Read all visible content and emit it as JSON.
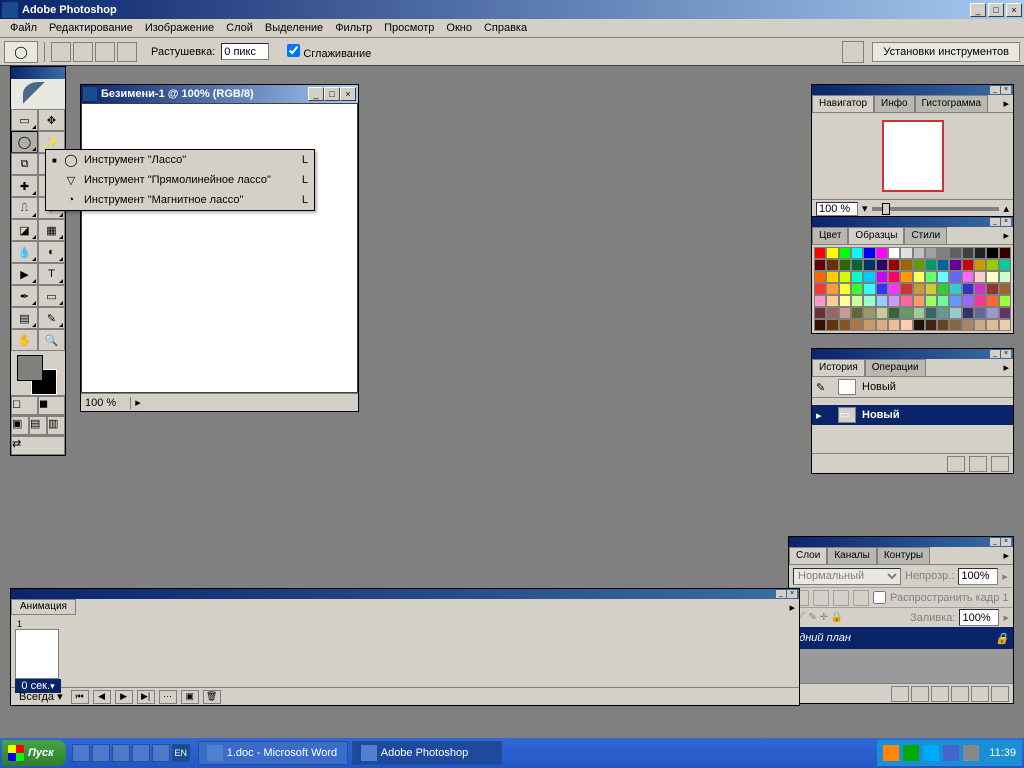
{
  "app": {
    "title": "Adobe Photoshop"
  },
  "menubar": [
    "Файл",
    "Редактирование",
    "Изображение",
    "Слой",
    "Выделение",
    "Фильтр",
    "Просмотр",
    "Окно",
    "Справка"
  ],
  "options": {
    "feather_label": "Растушевка:",
    "feather_value": "0 пикс",
    "antialias_label": "Сглаживание",
    "presets": "Установки инструментов"
  },
  "document": {
    "title": "Безимени-1 @ 100% (RGB/8)",
    "zoom": "100 %"
  },
  "flyout": {
    "items": [
      {
        "label": "Инструмент \"Лассо\"",
        "key": "L",
        "active": true
      },
      {
        "label": "Инструмент \"Прямолинейное лассо\"",
        "key": "L",
        "active": false
      },
      {
        "label": "Инструмент \"Магнитное лассо\"",
        "key": "L",
        "active": false
      }
    ]
  },
  "navigator": {
    "tabs": [
      "Навигатор",
      "Инфо",
      "Гистограмма"
    ],
    "zoom": "100 %"
  },
  "color": {
    "tabs": [
      "Цвет",
      "Образцы",
      "Стили"
    ]
  },
  "swatches": [
    "#ff0000",
    "#ffff00",
    "#00ff00",
    "#00ffff",
    "#0000ff",
    "#ff00ff",
    "#ffffff",
    "#e0e0e0",
    "#c0c0c0",
    "#a0a0a0",
    "#808080",
    "#606060",
    "#404040",
    "#202020",
    "#000000",
    "#330000",
    "#660000",
    "#663300",
    "#336600",
    "#006633",
    "#003366",
    "#330066",
    "#990000",
    "#996600",
    "#669900",
    "#009966",
    "#006699",
    "#660099",
    "#cc0000",
    "#cc9900",
    "#99cc00",
    "#00cc99",
    "#ff6600",
    "#ffcc00",
    "#ccff00",
    "#00ffcc",
    "#00ccff",
    "#cc00ff",
    "#ff0066",
    "#ff9900",
    "#ffff66",
    "#66ff66",
    "#66ffff",
    "#6666ff",
    "#ff66ff",
    "#ffcccc",
    "#ffffcc",
    "#ccffcc",
    "#ff3333",
    "#ff9933",
    "#ffff33",
    "#33ff33",
    "#33ffff",
    "#3333ff",
    "#ff33ff",
    "#cc3333",
    "#cc9933",
    "#cccc33",
    "#33cc33",
    "#33cccc",
    "#3333cc",
    "#cc33cc",
    "#993333",
    "#996633",
    "#ff99cc",
    "#ffcc99",
    "#ffff99",
    "#ccff99",
    "#99ffcc",
    "#99ccff",
    "#cc99ff",
    "#ff6699",
    "#ff9966",
    "#99ff66",
    "#66ff99",
    "#6699ff",
    "#9966ff",
    "#ff3399",
    "#ff6633",
    "#99ff33",
    "#663333",
    "#996666",
    "#cc9999",
    "#666633",
    "#999966",
    "#cccc99",
    "#336633",
    "#669966",
    "#99cc99",
    "#336666",
    "#669999",
    "#99cccc",
    "#333366",
    "#666699",
    "#9999cc",
    "#663366",
    "#331100",
    "#663311",
    "#885522",
    "#aa7744",
    "#cc9966",
    "#ddaa88",
    "#eebb99",
    "#ffccaa",
    "#221100",
    "#442211",
    "#664422",
    "#886644",
    "#aa8866",
    "#ccaa88",
    "#ddbb99",
    "#eeccaa"
  ],
  "history": {
    "tabs": [
      "История",
      "Операции"
    ],
    "snapshot": "Новый",
    "state": "Новый"
  },
  "layers": {
    "tabs": [
      "Слои",
      "Каналы",
      "Контуры"
    ],
    "blend": "Нормальный",
    "opacity_label": "Непрозр.:",
    "opacity": "100%",
    "propagate": "Распространить кадр 1",
    "fill_label": "Заливка:",
    "fill": "100%",
    "layer_name": "адний план"
  },
  "animation": {
    "tab": "Анимация",
    "frame_num": "1",
    "frame_time": "0 сек.",
    "loop": "Всегда"
  },
  "taskbar": {
    "start": "Пуск",
    "tasks": [
      "1.doc - Microsoft Word",
      "Adobe Photoshop"
    ],
    "time": "11:39"
  }
}
